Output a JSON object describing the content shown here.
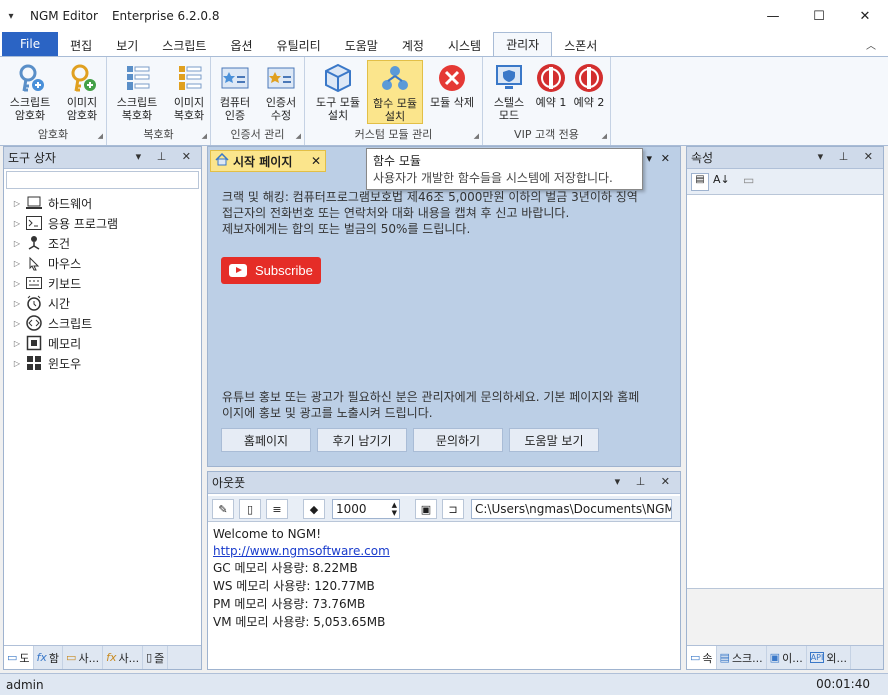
{
  "window": {
    "title": "NGM Editor",
    "edition": "Enterprise 6.2.0.8"
  },
  "menu": [
    "File",
    "편집",
    "보기",
    "스크립트",
    "옵션",
    "유틸리티",
    "도움말",
    "계정",
    "시스템",
    "관리자",
    "스폰서"
  ],
  "ribbon": {
    "groups": [
      {
        "label": "암호화",
        "buttons": [
          "스크립트\n암호화",
          "이미지\n암호화"
        ]
      },
      {
        "label": "복호화",
        "buttons": [
          "스크립트\n복호화",
          "이미지\n복호화"
        ]
      },
      {
        "label": "인증서 관리",
        "buttons": [
          "컴퓨터\n인증",
          "인증서\n수정"
        ]
      },
      {
        "label": "커스텀 모듈 관리",
        "buttons": [
          "도구 모듈\n설치",
          "함수 모듈\n설치",
          "모듈 삭제"
        ]
      },
      {
        "label": "VIP 고객 전용",
        "buttons": [
          "스텔스\n모드",
          "예약 1",
          "예약 2"
        ]
      }
    ]
  },
  "toolbox": {
    "title": "도구 상자",
    "items": [
      "하드웨어",
      "응용 프로그램",
      "조건",
      "마우스",
      "키보드",
      "시간",
      "스크립트",
      "메모리",
      "윈도우"
    ],
    "tabs": [
      "도",
      "함",
      "사...",
      "사...",
      "즐"
    ]
  },
  "doc": {
    "tab": "시작 페이지",
    "line1": "크랙 및 해킹: 컴퓨터프로그램보호법 제46조 5,000만원 이하의 벌금 3년이하 징역",
    "line2": "접근자의 전화번호 또는 연락처와 대화 내용을 캡쳐 후 신고 바랍니다.",
    "line3": "제보자에게는 합의 또는 벌금의 50%를 드립니다.",
    "subscribe": "Subscribe",
    "promo1": "유튜브 홍보 또는 광고가 필요하신 분은 관리자에게 문의하세요. 기본 페이지와 홈페",
    "promo2": "이지에 홍보 및 광고를 노출시켜 드립니다.",
    "buttons": [
      "홈페이지",
      "후기 남기기",
      "문의하기",
      "도움말 보기"
    ]
  },
  "tooltip": {
    "title": "함수 모듈",
    "text": "사용자가 개발한 함수들을 시스템에 저장합니다."
  },
  "output": {
    "title": "아웃풋",
    "number": "1000",
    "path": "C:\\Users\\ngmas\\Documents\\NGM6\\",
    "lines": [
      "Welcome to NGM!",
      "http://www.ngmsoftware.com",
      "GC 메모리 사용량: 8.22MB",
      "WS 메모리 사용량: 120.77MB",
      "PM 메모리 사용량: 73.76MB",
      "VM 메모리 사용량: 5,053.65MB"
    ]
  },
  "props": {
    "title": "속성",
    "tabs": [
      "속",
      "스크...",
      "이...",
      "외..."
    ]
  },
  "status": {
    "user": "admin",
    "time": "00:01:40"
  },
  "colors": {
    "accent": "#2b64c4",
    "selected": "#fbe58c",
    "panel": "#cfdaea"
  }
}
